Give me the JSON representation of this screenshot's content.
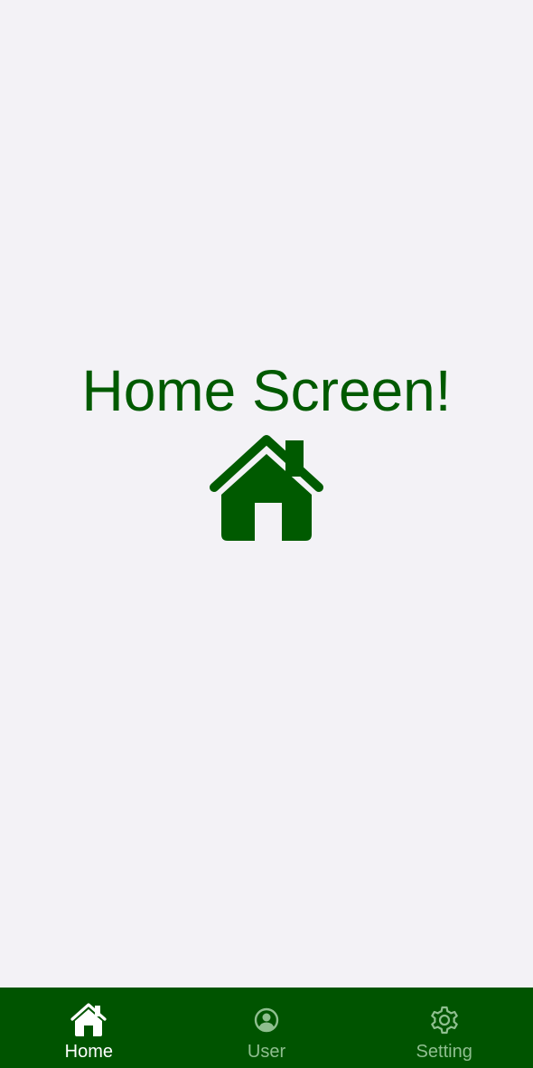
{
  "main": {
    "headline": "Home Screen!",
    "hero_icon": "home-icon",
    "accent_color": "#005a00"
  },
  "tabbar": {
    "background_color": "#005400",
    "active_index": 0,
    "items": [
      {
        "label": "Home",
        "icon": "home-icon",
        "active": true
      },
      {
        "label": "User",
        "icon": "user-icon",
        "active": false
      },
      {
        "label": "Setting",
        "icon": "gear-icon",
        "active": false
      }
    ]
  }
}
